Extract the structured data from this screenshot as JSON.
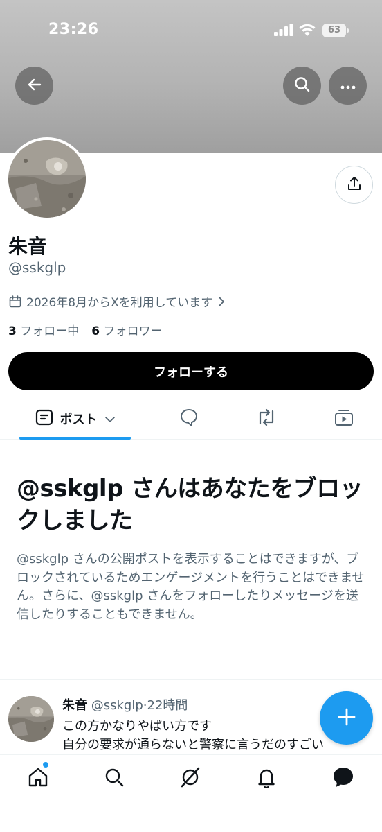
{
  "status_bar": {
    "time": "23:26",
    "battery": "63"
  },
  "profile": {
    "name": "朱音",
    "handle": "@sskglp",
    "joined": "2026年8月からXを利用しています",
    "following_count": "3",
    "following_label": "フォロー中",
    "followers_count": "6",
    "followers_label": "フォロワー",
    "follow_button": "フォローする"
  },
  "tabs": {
    "posts": "ポスト"
  },
  "blocked": {
    "title": "@sskglp さんはあなたをブロックしました",
    "description": "@sskglp さんの公開ポストを表示することはできますが、ブロックされているためエンゲージメントを行うことはできません。さらに、@sskglp さんをフォローしたりメッセージを送信したりすることもできません。"
  },
  "tweet": {
    "name": "朱音",
    "meta": "@sskglp·22時間",
    "line1": "この方かなりやばい方です",
    "line2": "自分の要求が通らないと警察に言うだのすごい"
  },
  "colors": {
    "accent": "#1d9bf0",
    "text": "#0f1419",
    "muted": "#536471"
  },
  "icons": [
    "back-arrow-icon",
    "search-icon",
    "more-icon",
    "share-icon",
    "calendar-icon",
    "chevron-right-icon",
    "posts-icon",
    "chevron-down-icon",
    "reply-icon",
    "repost-icon",
    "video-icon",
    "plus-icon",
    "home-icon",
    "grok-icon",
    "bell-icon",
    "message-icon"
  ]
}
